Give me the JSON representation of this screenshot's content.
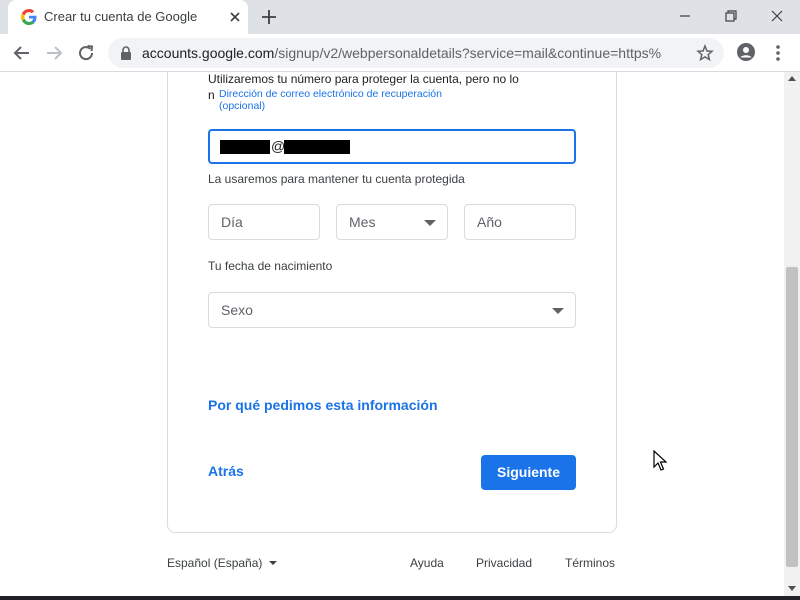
{
  "browser": {
    "tab_title": "Crear tu cuenta de Google",
    "url_host": "accounts.google.com",
    "url_path": "/signup/v2/webpersonaldetails?service=mail&continue=https%3..."
  },
  "form": {
    "phone_notice": "Utilizaremos tu número para proteger la cuenta, pero no lo",
    "phone_notice_cut": "n",
    "recovery_email_label_line1": "Dirección de correo electrónico de recuperación",
    "recovery_email_label_line2": "(opcional)",
    "recovery_email_at": "@",
    "recovery_email_helper": "La usaremos para mantener tu cuenta protegida",
    "day_placeholder": "Día",
    "month_placeholder": "Mes",
    "year_placeholder": "Año",
    "dob_helper": "Tu fecha de nacimiento",
    "gender_placeholder": "Sexo",
    "why_link": "Por qué pedimos esta información",
    "back_label": "Atrás",
    "next_label": "Siguiente"
  },
  "footer": {
    "language": "Español (España)",
    "help": "Ayuda",
    "privacy": "Privacidad",
    "terms": "Términos"
  },
  "colors": {
    "accent": "#1a73e8",
    "border": "#dadce0",
    "tabstrip": "#dee1e6"
  }
}
